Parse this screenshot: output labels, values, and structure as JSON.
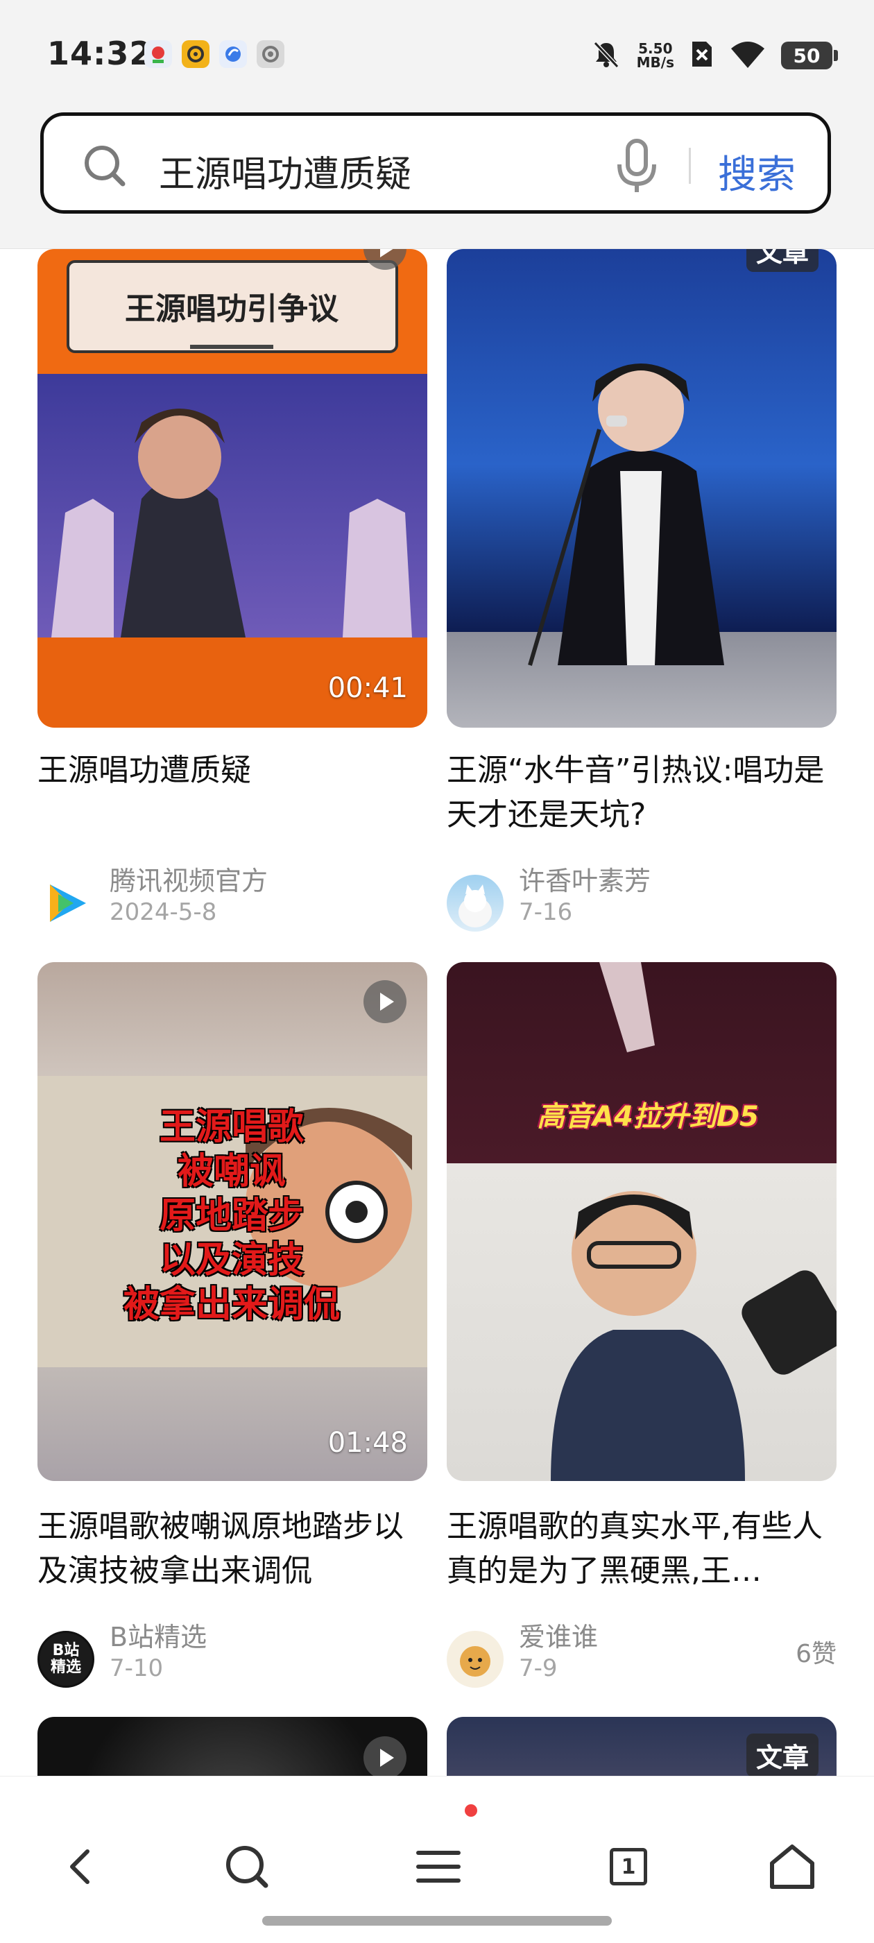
{
  "status_bar": {
    "time": "14:32",
    "net_speed_value": "5.50",
    "net_speed_unit": "MB/s",
    "battery": "50",
    "icons": [
      "map-app-icon",
      "music-app-icon",
      "browser-app-icon",
      "settings-app-icon",
      "mute-icon",
      "sim-off-icon",
      "wifi-icon",
      "battery-icon"
    ]
  },
  "search": {
    "query": "王源唱功遭质疑",
    "button_label": "搜索",
    "accent_color": "#3a6fd8"
  },
  "feed": {
    "items": [
      {
        "title": "王源唱功遭质疑",
        "duration": "00:41",
        "overlay_text": "王源唱功引争议",
        "author": "腾讯视频官方",
        "date": "2024-5-8"
      },
      {
        "title": "王源“水牛音”引热议:唱功是天才还是天坑?",
        "tag": "文章",
        "author": "许香叶素芳",
        "date": "7-16"
      },
      {
        "title": "王源唱歌被嘲讽原地踏步以及演技被拿出来调侃",
        "duration": "01:48",
        "overlay_lines": [
          "王源唱歌",
          "被嘲讽",
          "原地踏步",
          "以及演技",
          "被拿出来调侃"
        ],
        "author": "B站精选",
        "avatar_text": "B站精选",
        "date": "7-10"
      },
      {
        "title": "王源唱歌的真实水平,有些人真的是为了黑硬黑,王…",
        "overlay_text": "高音A4拉升到D5",
        "author": "爱谁谁",
        "date": "7-9",
        "likes": "6赞"
      },
      {
        "tag": "文章"
      }
    ]
  },
  "bottom_nav": {
    "tab_count": "1"
  }
}
